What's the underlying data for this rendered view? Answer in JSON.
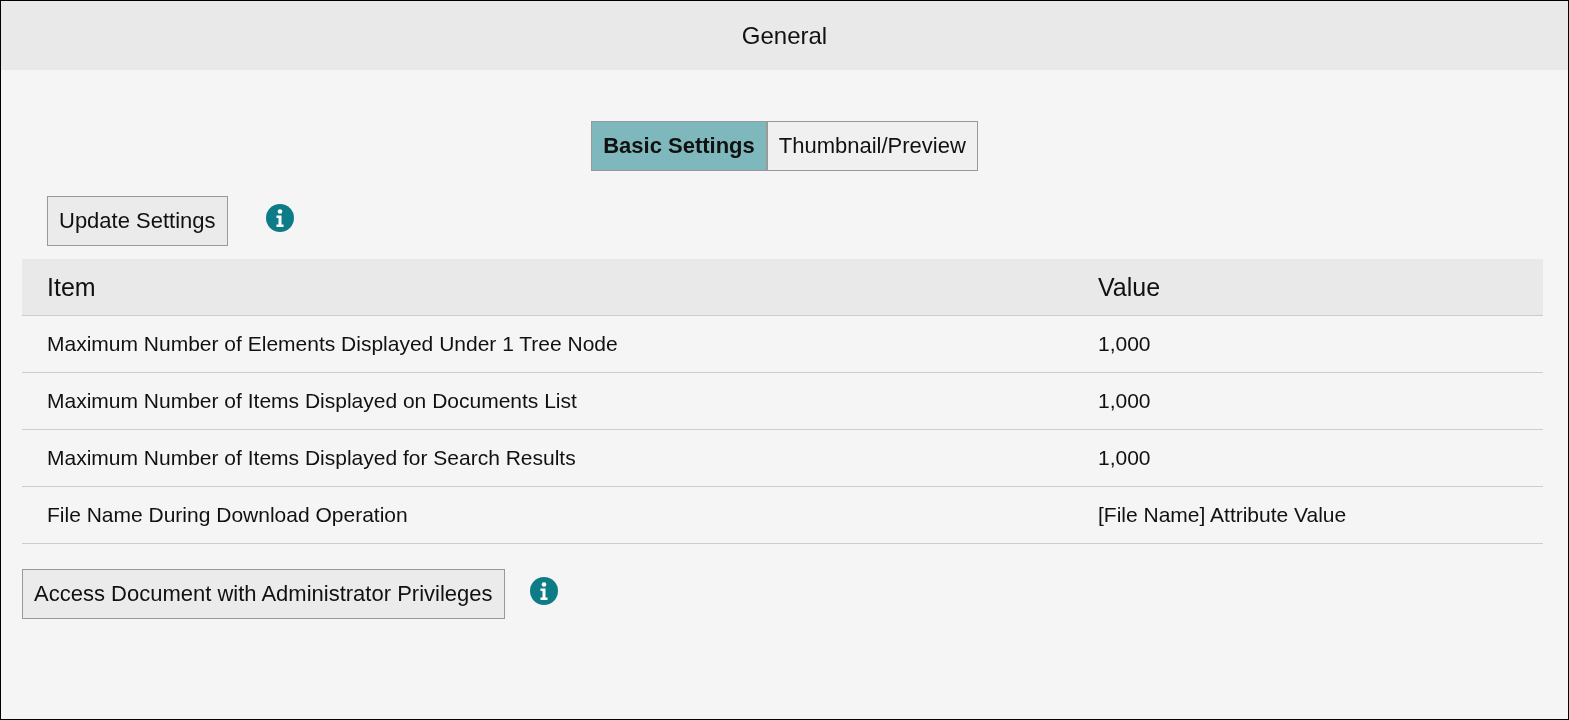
{
  "header": {
    "title": "General"
  },
  "tabs": [
    {
      "label": "Basic Settings",
      "selected": true
    },
    {
      "label": "Thumbnail/Preview",
      "selected": false
    }
  ],
  "update_button": {
    "label": "Update Settings"
  },
  "table": {
    "columns": [
      "Item",
      "Value"
    ],
    "rows": [
      {
        "item": "Maximum Number of Elements Displayed Under 1 Tree Node",
        "value": "1,000"
      },
      {
        "item": "Maximum Number of Items Displayed on Documents List",
        "value": "1,000"
      },
      {
        "item": "Maximum Number of Items Displayed for Search Results",
        "value": "1,000"
      },
      {
        "item": "File Name During Download Operation",
        "value": "[File Name] Attribute Value"
      }
    ]
  },
  "admin_button": {
    "label": "Access Document with Administrator Privileges"
  }
}
